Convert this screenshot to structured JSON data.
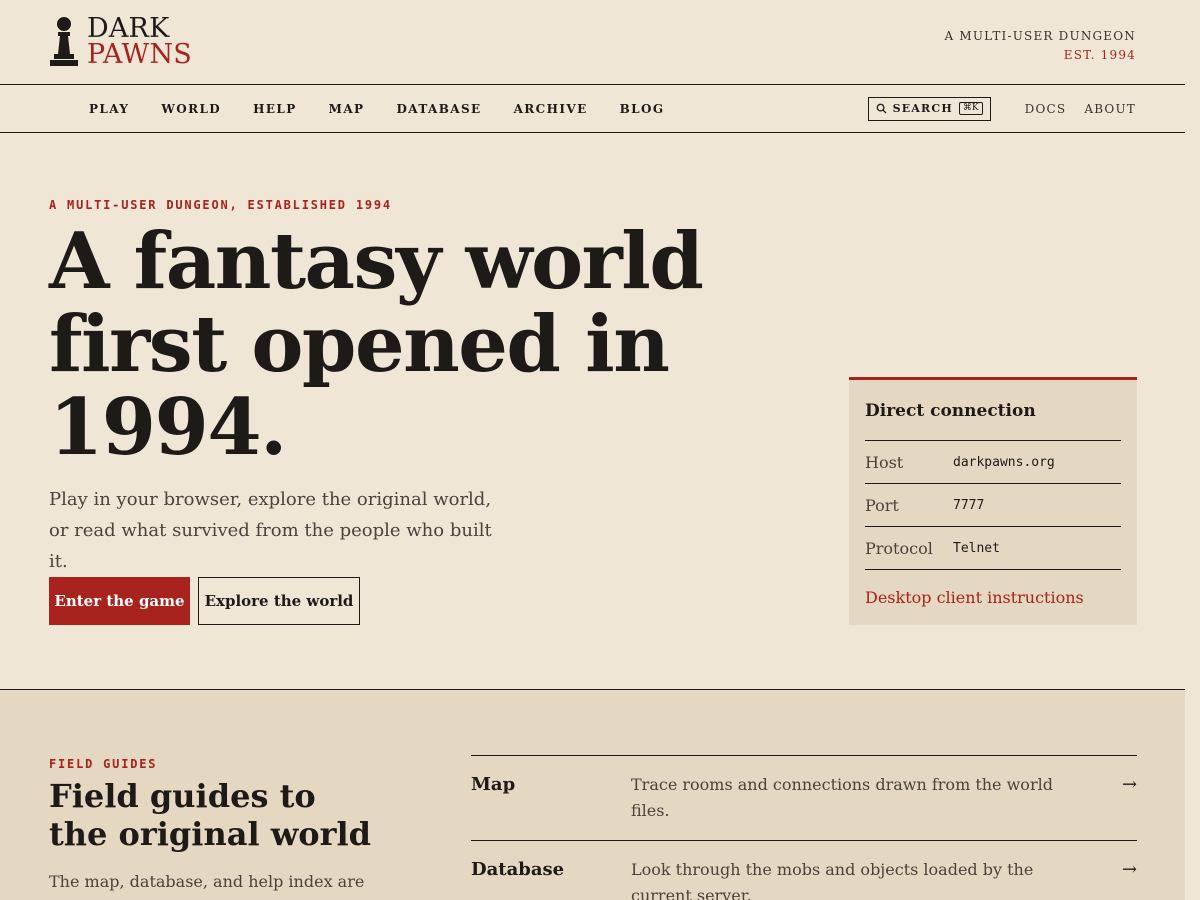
{
  "brand": {
    "line1": "DARK",
    "line2": "PAWNS",
    "tagline_1": "A MULTI-USER DUNGEON",
    "tagline_2": "EST. 1994"
  },
  "nav": {
    "items": [
      {
        "label": "PLAY"
      },
      {
        "label": "WORLD"
      },
      {
        "label": "HELP"
      },
      {
        "label": "MAP"
      },
      {
        "label": "DATABASE"
      },
      {
        "label": "ARCHIVE"
      },
      {
        "label": "BLOG"
      }
    ],
    "search_label": "SEARCH",
    "search_shortcut": "⌘K",
    "docs_label": "DOCS",
    "about_label": "ABOUT"
  },
  "hero": {
    "eyebrow": "A MULTI-USER DUNGEON, ESTABLISHED 1994",
    "title_line1": "A fantasy world",
    "title_line2": "first opened in",
    "title_line3": "1994.",
    "subtitle": "Play in your browser, explore the original world, or read what survived from the people who built it.",
    "primary_button": "Enter the game",
    "secondary_button": "Explore the world"
  },
  "connection": {
    "title": "Direct connection",
    "rows": [
      {
        "key": "Host",
        "value": "darkpawns.org"
      },
      {
        "key": "Port",
        "value": "7777"
      },
      {
        "key": "Protocol",
        "value": "Telnet"
      }
    ],
    "link": "Desktop client instructions"
  },
  "guides": {
    "eyebrow": "FIELD GUIDES",
    "title": "Field guides to the original world",
    "description": "The map, database, and help index are",
    "items": [
      {
        "name": "Map",
        "description": "Trace rooms and connections drawn from the world files.",
        "arrow": "→"
      },
      {
        "name": "Database",
        "description": "Look through the mobs and objects loaded by the current server.",
        "arrow": "→"
      }
    ]
  },
  "colors": {
    "background": "#efe6d6",
    "panel": "#e5d8c2",
    "accent": "#a8231d",
    "ink": "#1e1a17"
  }
}
